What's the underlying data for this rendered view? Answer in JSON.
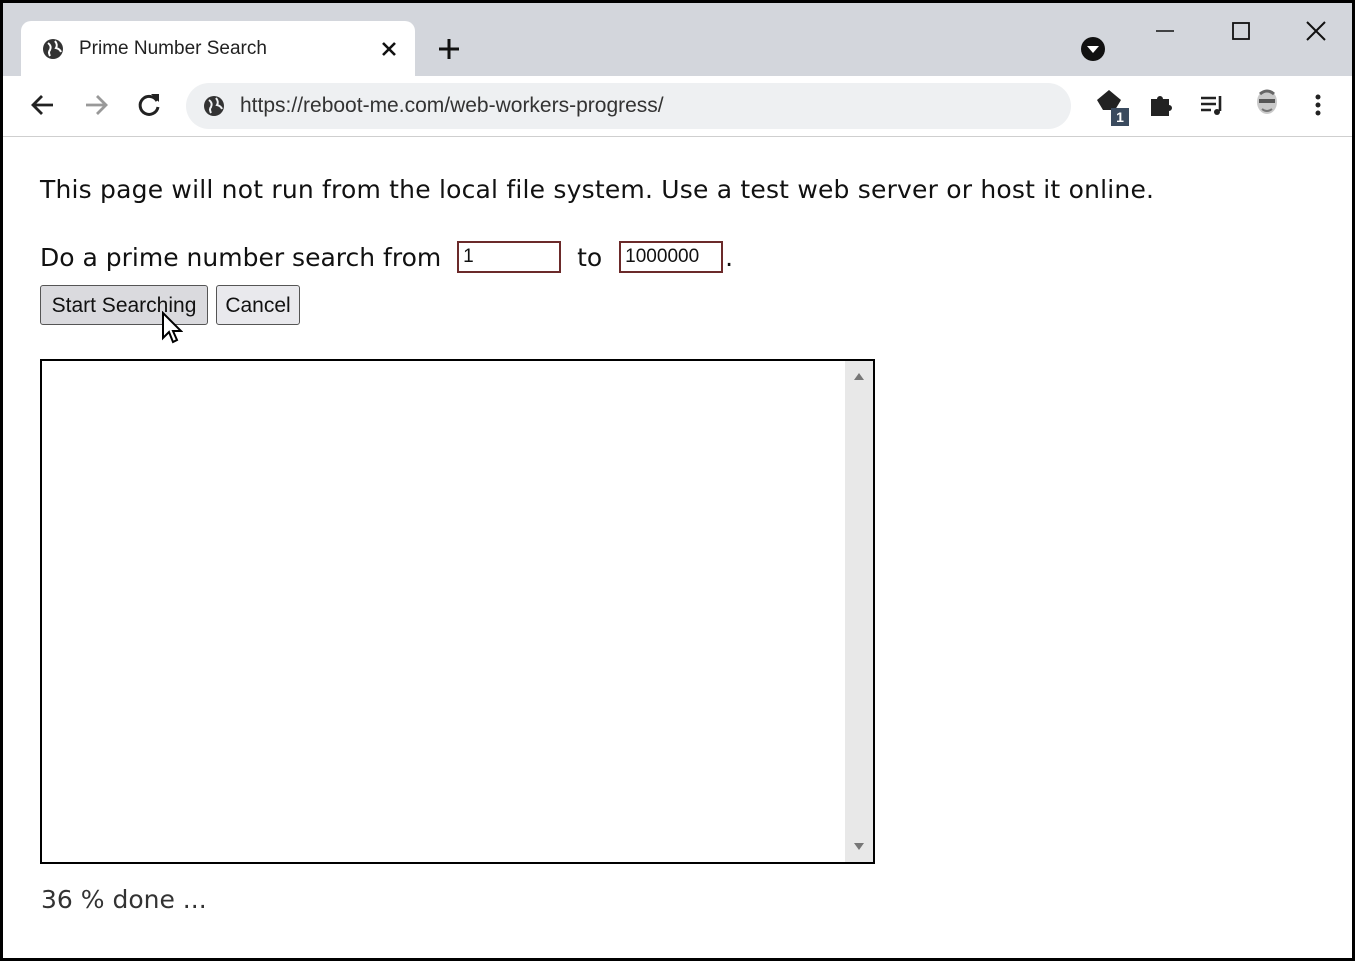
{
  "browser": {
    "tab": {
      "title": "Prime Number Search"
    },
    "address_bar": {
      "url": "https://reboot-me.com/web-workers-progress/"
    },
    "extension_badge": "1"
  },
  "page": {
    "notice": "This page will not run from the local file system. Use a test web server or host it online.",
    "search": {
      "prefix": "Do a prime number search from ",
      "from_value": "1",
      "middle": " to ",
      "to_value": "1000000",
      "suffix": "."
    },
    "buttons": {
      "start": "Start Searching",
      "cancel": "Cancel"
    },
    "results_text": "",
    "status": "36 % done ..."
  }
}
